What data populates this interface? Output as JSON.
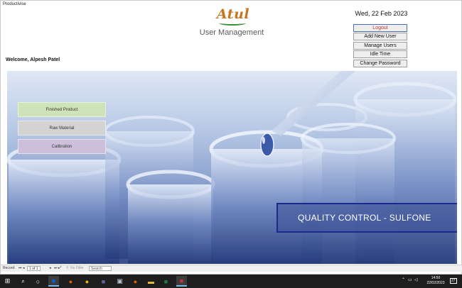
{
  "window": {
    "title": "Productivise"
  },
  "header": {
    "logo_text": "Atul",
    "subtitle": "User Management",
    "date": "Wed, 22 Feb 2023",
    "welcome": "Welcome, Alpesh Patel"
  },
  "menu": {
    "logout": "Logout",
    "add_user": "Add New User",
    "manage_users": "Manage Users",
    "idle_time": "Idle Time",
    "change_password": "Change Password"
  },
  "nav": {
    "finished_product": "Finished Product",
    "raw_material": "Raw Material",
    "calibration": "Calibration"
  },
  "nav_colors": {
    "finished_product": "#cfe3b8",
    "raw_material": "#d3d3d3",
    "calibration": "#cdbfda"
  },
  "banner": {
    "text": "QUALITY CONTROL - SULFONE"
  },
  "record_nav": {
    "label": "Record:",
    "position": "1 of 1",
    "filter": "No Filter",
    "search_placeholder": "Search"
  },
  "taskbar": {
    "time": "14:50",
    "date": "22/02/2023",
    "notification_count": "27",
    "icons": [
      "windows-start-icon",
      "search-icon",
      "task-view-icon",
      "outlook-icon",
      "firefox-icon",
      "chrome-icon",
      "teams-icon",
      "firefox-icon",
      "file-explorer-icon",
      "excel-icon",
      "sticky-notes-icon",
      "access-icon"
    ]
  }
}
